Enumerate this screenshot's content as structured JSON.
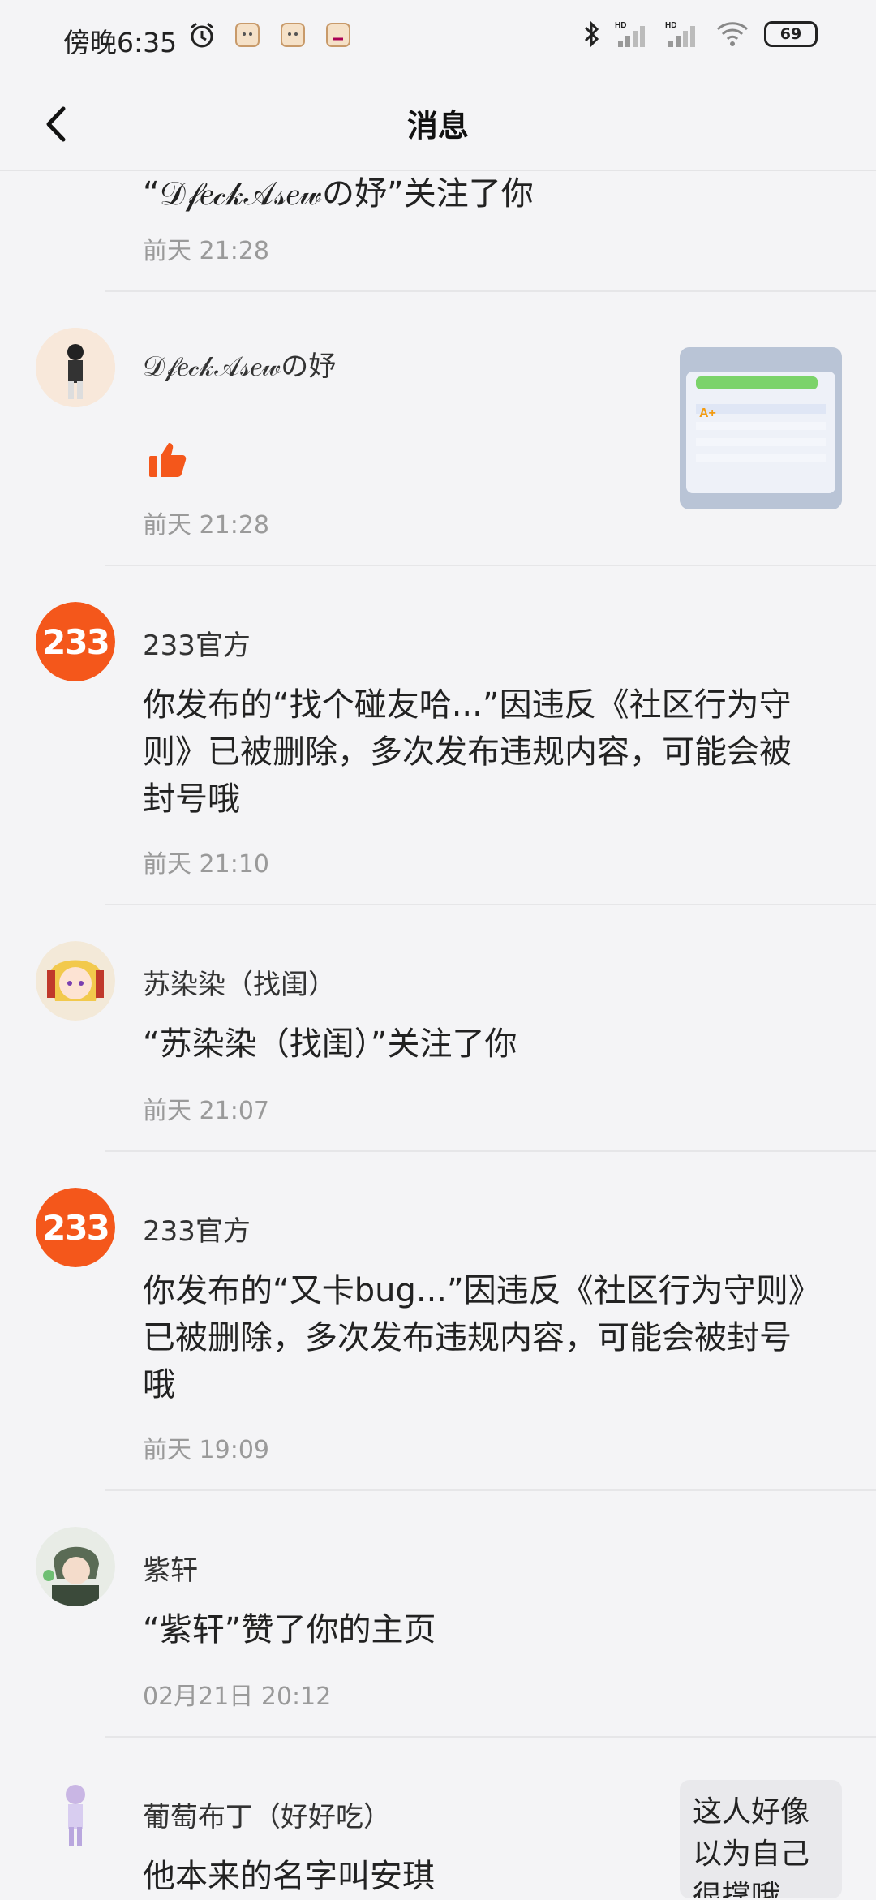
{
  "status_bar": {
    "time": "傍晚6:35",
    "icons": [
      "alarm-icon",
      "app-icon",
      "app-icon",
      "app-icon",
      "bluetooth-icon",
      "signal-icon",
      "signal-icon",
      "wifi-icon"
    ],
    "battery": "69"
  },
  "header": {
    "title": "消息"
  },
  "messages": [
    {
      "text": "“𝒟𝒻𝑒𝒸𝓀𝒜𝓈𝑒𝓌の妤”关注了你",
      "time": "前天 21:28"
    },
    {
      "name": "𝒟𝒻𝑒𝒸𝓀𝒜𝓈𝑒𝓌の妤",
      "time": "前天 21:28",
      "icon": "thumbs-up-icon"
    },
    {
      "name": "233官方",
      "text": "你发布的“找个碰友哈...”因违反《社区行为守则》已被删除，多次发布违规内容，可能会被封号哦",
      "time": "前天 21:10"
    },
    {
      "name": "苏染染（找闺）",
      "text": "“苏染染（找闺）”关注了你",
      "time": "前天 21:07"
    },
    {
      "name": "233官方",
      "text": "你发布的“又卡bug...”因违反《社区行为守则》已被删除，多次发布违规内容，可能会被封号哦",
      "time": "前天 19:09"
    },
    {
      "name": "紫轩",
      "text": "“紫轩”赞了你的主页",
      "time": "02月21日 20:12"
    },
    {
      "name": "葡萄布丁（好好吃）",
      "text": "他本来的名字叫安琪",
      "quote": "这人好像以为自己很撑哦"
    }
  ],
  "logo_text": "233",
  "colors": {
    "accent": "#f4571b",
    "background": "#f4f4f6"
  }
}
